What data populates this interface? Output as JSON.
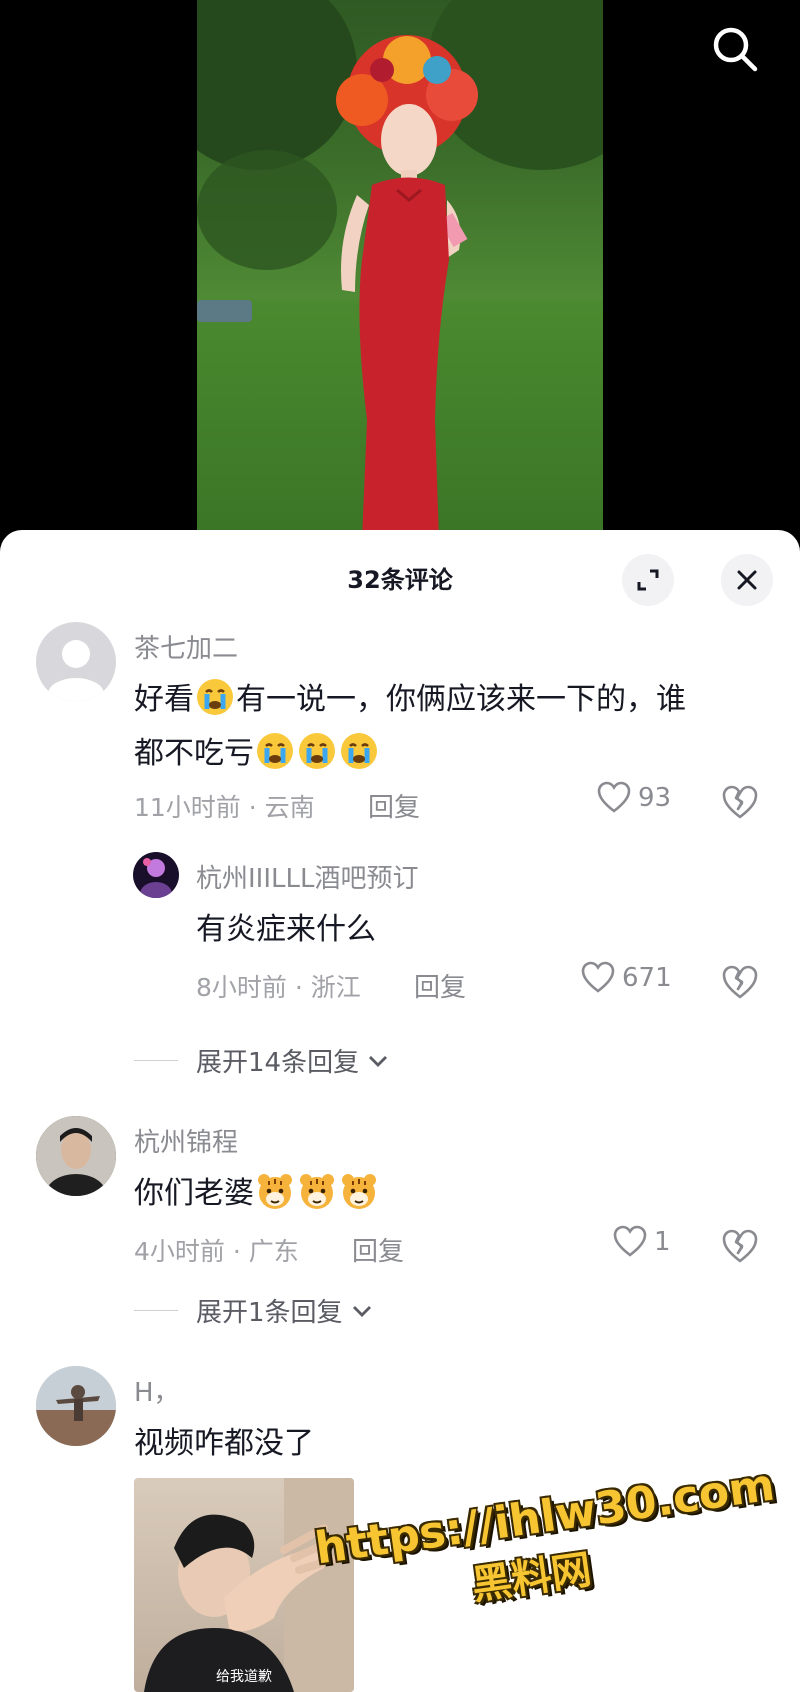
{
  "sheet": {
    "title": "32条评论"
  },
  "icons": {
    "search": "search-icon",
    "expand": "expand-icon",
    "close": "close-icon",
    "like": "heart-icon",
    "dislike": "broken-heart-icon"
  },
  "comments": [
    {
      "user": "茶七加二",
      "text_line1_a": "好看",
      "text_line1_b": "有一说一，你俩应该来一下的，谁",
      "text_line2": "都不吃亏",
      "time": "11小时前 · 云南",
      "reply_label": "回复",
      "likes": "93",
      "sub_reply": {
        "user": "杭州IIILLL酒吧预订",
        "text": "有炎症来什么",
        "time": "8小时前 · 浙江",
        "reply_label": "回复",
        "likes": "671"
      },
      "expand_label": "展开14条回复"
    },
    {
      "user": "杭州锦程",
      "text": "你们老婆",
      "time": "4小时前 · 广东",
      "reply_label": "回复",
      "likes": "1",
      "expand_label": "展开1条回复"
    },
    {
      "user": "H，",
      "text": "视频咋都没了",
      "sticker_caption": "给我道歉"
    }
  ],
  "watermark": {
    "url": "https://ihlw30.com",
    "sub": "黑料网"
  },
  "colors": {
    "text": "#161823",
    "secondary": "#8a8b91",
    "meta": "#a1a2a7",
    "sheet_bg": "#ffffff",
    "dress": "#c8232c"
  }
}
